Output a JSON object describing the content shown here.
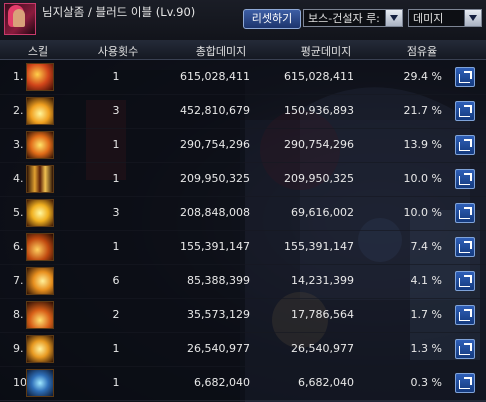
{
  "window": {
    "title": "님지살좀 / 블러드 이블 (Lv.90)",
    "reset_label": "리셋하기",
    "target_select": "보스-건설자 루:",
    "metric_select": "데미지"
  },
  "columns": [
    "스킬",
    "사용횟수",
    "총합데미지",
    "평균데미지",
    "점유율"
  ],
  "rows": [
    {
      "num": "1.",
      "icon": "blood-burst-skill-icon",
      "count": "1",
      "total": "615,028,411",
      "avg": "615,028,411",
      "pct": "29.4 %"
    },
    {
      "num": "2.",
      "icon": "explosion-skill-icon",
      "count": "3",
      "total": "452,810,679",
      "avg": "150,936,893",
      "pct": "21.7 %"
    },
    {
      "num": "3.",
      "icon": "flame-skill-icon",
      "count": "1",
      "total": "290,754,296",
      "avg": "290,754,296",
      "pct": "13.9 %"
    },
    {
      "num": "4.",
      "icon": "pillar-skill-icon",
      "count": "1",
      "total": "209,950,325",
      "avg": "209,950,325",
      "pct": "10.0 %"
    },
    {
      "num": "5.",
      "icon": "burst-skill-icon",
      "count": "3",
      "total": "208,848,008",
      "avg": "69,616,002",
      "pct": "10.0 %"
    },
    {
      "num": "6.",
      "icon": "slash-skill-icon",
      "count": "1",
      "total": "155,391,147",
      "avg": "155,391,147",
      "pct": "7.4 %"
    },
    {
      "num": "7.",
      "icon": "rush-skill-icon",
      "count": "6",
      "total": "85,388,399",
      "avg": "14,231,399",
      "pct": "4.1 %"
    },
    {
      "num": "8.",
      "icon": "fire-wave-skill-icon",
      "count": "2",
      "total": "35,573,129",
      "avg": "17,786,564",
      "pct": "1.7 %"
    },
    {
      "num": "9.",
      "icon": "strike-skill-icon",
      "count": "1",
      "total": "26,540,977",
      "avg": "26,540,977",
      "pct": "1.3 %"
    },
    {
      "num": "10.",
      "icon": "vortex-skill-icon",
      "count": "1",
      "total": "6,682,040",
      "avg": "6,682,040",
      "pct": "0.3 %"
    }
  ],
  "colors": {
    "accent": "#3d5ea5",
    "header_bg": "#242a38"
  }
}
